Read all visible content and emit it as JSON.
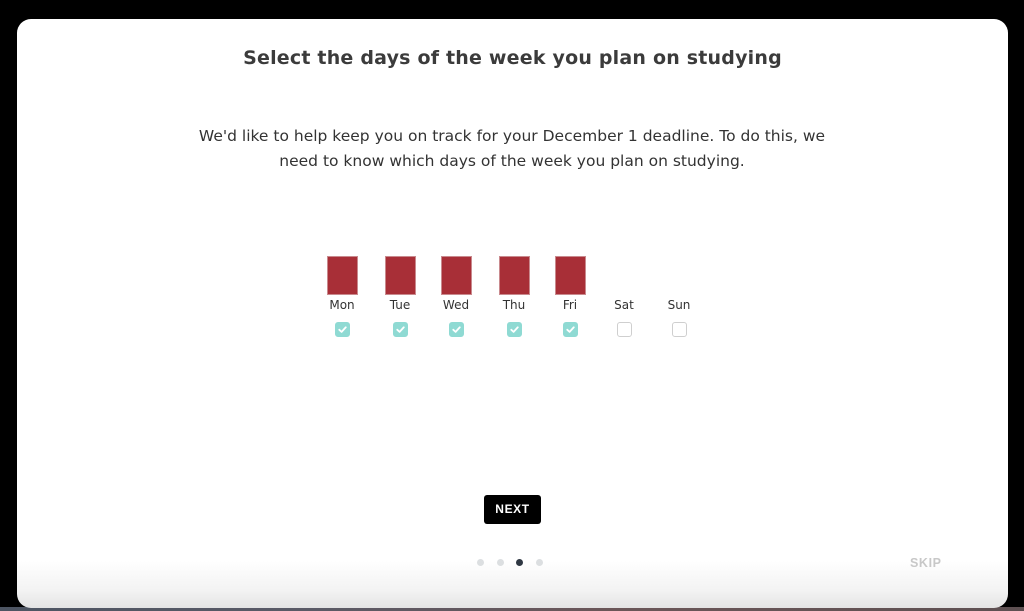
{
  "dialog": {
    "title": "Select the days of the week you plan on studying",
    "description": "We'd like to help keep you on track for your December 1 deadline. To do this, we need to know which days of the week you plan on studying."
  },
  "days": [
    {
      "label": "Mon",
      "selected": true
    },
    {
      "label": "Tue",
      "selected": true
    },
    {
      "label": "Wed",
      "selected": true
    },
    {
      "label": "Thu",
      "selected": true
    },
    {
      "label": "Fri",
      "selected": true
    },
    {
      "label": "Sat",
      "selected": false
    },
    {
      "label": "Sun",
      "selected": false
    }
  ],
  "actions": {
    "next_label": "NEXT",
    "skip_label": "SKIP"
  },
  "pager": {
    "total_steps": 4,
    "current_step": 3
  },
  "colors": {
    "selected_day_bar": "#a82f37",
    "checkbox_checked": "#8fdad3",
    "checkbox_unchecked_border": "#cfcfcf",
    "active_dot": "#2f3843",
    "inactive_dot": "#dcdfe1",
    "primary_button": "#000000",
    "skip_text": "#c8c8c8"
  }
}
